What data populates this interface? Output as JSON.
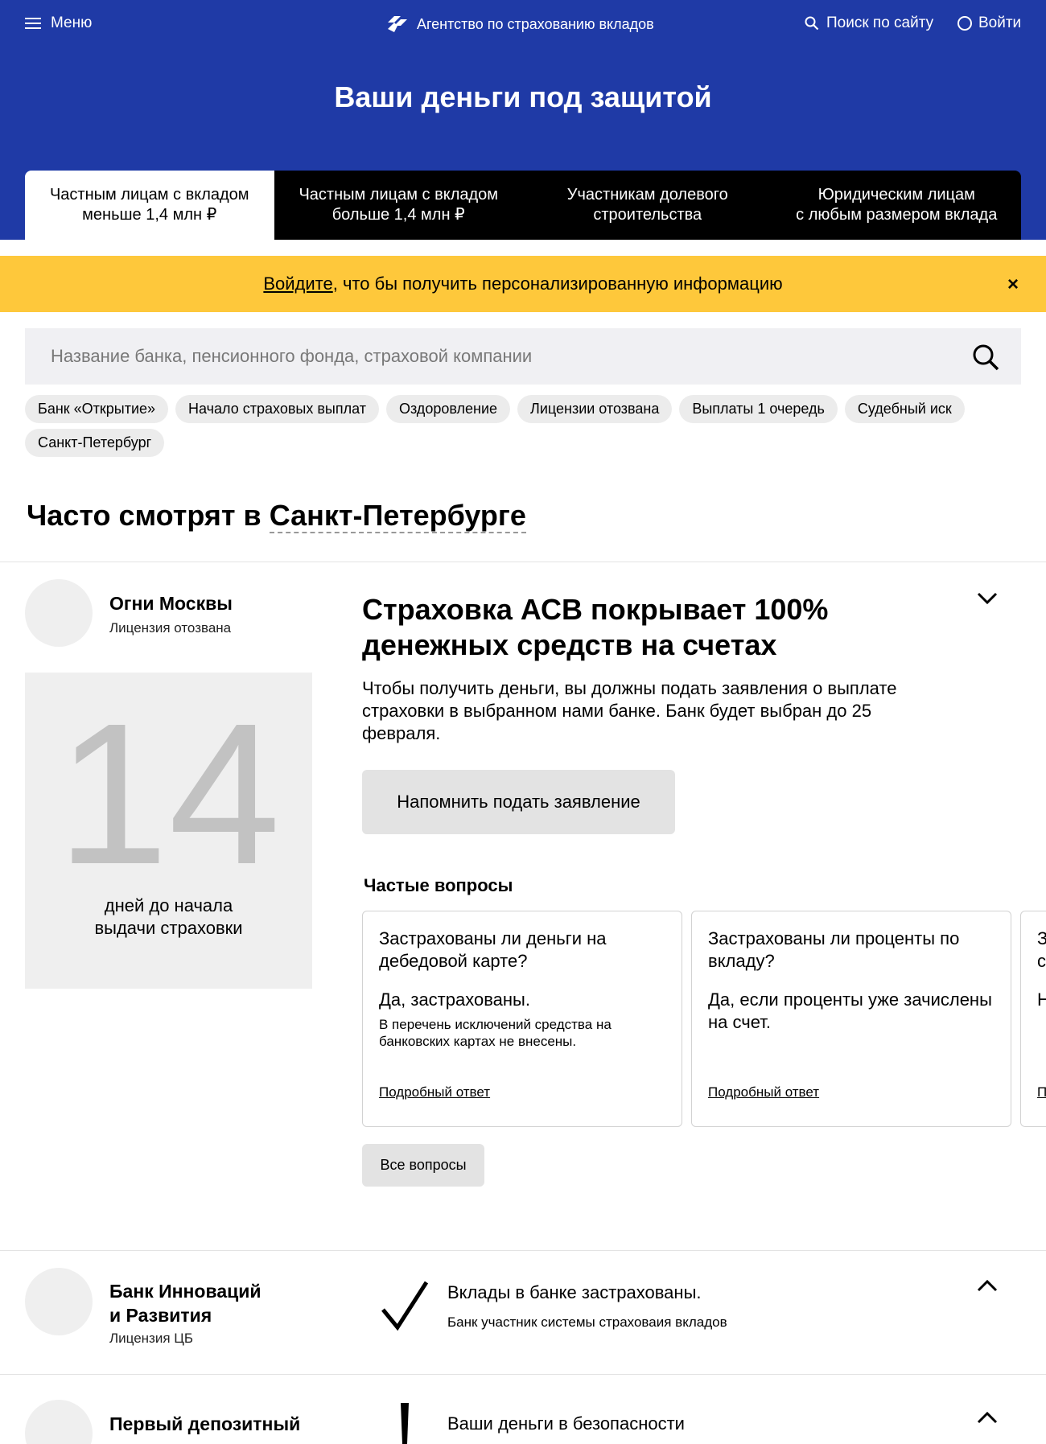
{
  "topbar": {
    "menu_label": "Меню",
    "brand_name": "Агентство по страхованию вкладов",
    "search_label": "Поиск по сайту",
    "login_label": "Войти"
  },
  "hero": {
    "title": "Ваши деньги под защитой"
  },
  "tabs": [
    {
      "label": "Частным лицам с вкладом\nменьше 1,4 млн ₽",
      "active": true
    },
    {
      "label": "Частным лицам с вкладом\nбольше 1,4 млн ₽"
    },
    {
      "label": "Участникам долевого\nстроительства"
    },
    {
      "label": "Юридическим лицам\nс любым размером вклада"
    }
  ],
  "notice": {
    "link_text": "Войдите",
    "text": ", что бы получить персонализированную информацию",
    "close": "×"
  },
  "search": {
    "placeholder": "Название банка, пенсионного фонда, страховой компании"
  },
  "chips": [
    "Банк «Открытие»",
    "Начало страховых выплат",
    "Оздоровление",
    "Лицензии отозвана",
    "Выплаты 1 очередь",
    "Судебный иск",
    "Санкт-Петербург"
  ],
  "section": {
    "title_prefix": "Часто смотрят в ",
    "city": "Санкт-Петербурге"
  },
  "banks": [
    {
      "name": "Огни Москвы",
      "status": "Лицензия отозвана",
      "counter_value": "14",
      "counter_label_1": "дней до начала",
      "counter_label_2": "выдачи страховки",
      "headline": "Страховка АСВ покрывает 100% денежных средств на счетах",
      "lead": "Чтобы получить деньги, вы должны подать заявления о выплате страховки в выбранном нами банке. Банк будет выбран до 25 февраля.",
      "remind_button": "Напомнить подать заявление",
      "faq_title": "Частые вопросы",
      "faq": [
        {
          "q": "Застрахованы ли деньги на дебедовой карте?",
          "a": "Да, застрахованы.",
          "note": "В перечень исключений средства на банковских картах не внесены.",
          "more": "Подробный ответ"
        },
        {
          "q": "Застрахованы ли проценты по вкладу?",
          "a": "Да, если проценты уже зачислены на счет.",
          "note": "",
          "more": "Подробный ответ"
        },
        {
          "q": "Застрахованы ли деньги на счете?",
          "a": "Нет, не застрахованы.",
          "note": "",
          "more": "Подробный ответ"
        }
      ],
      "all_questions": "Все вопросы"
    },
    {
      "name": "Банк Инноваций и Развития",
      "name_line1": "Банк Инноваций",
      "name_line2": "и Развития",
      "status": "Лицензия ЦБ",
      "status_head": "Вклады в банке застрахованы.",
      "status_sub": "Банк участник системы страховаия вкладов"
    },
    {
      "name_line1": "Первый депозитный",
      "status_head": "Ваши деньги в безопасности"
    }
  ],
  "colors": {
    "header_bg": "#1f3aa6",
    "notice_bg": "#fec83b"
  }
}
